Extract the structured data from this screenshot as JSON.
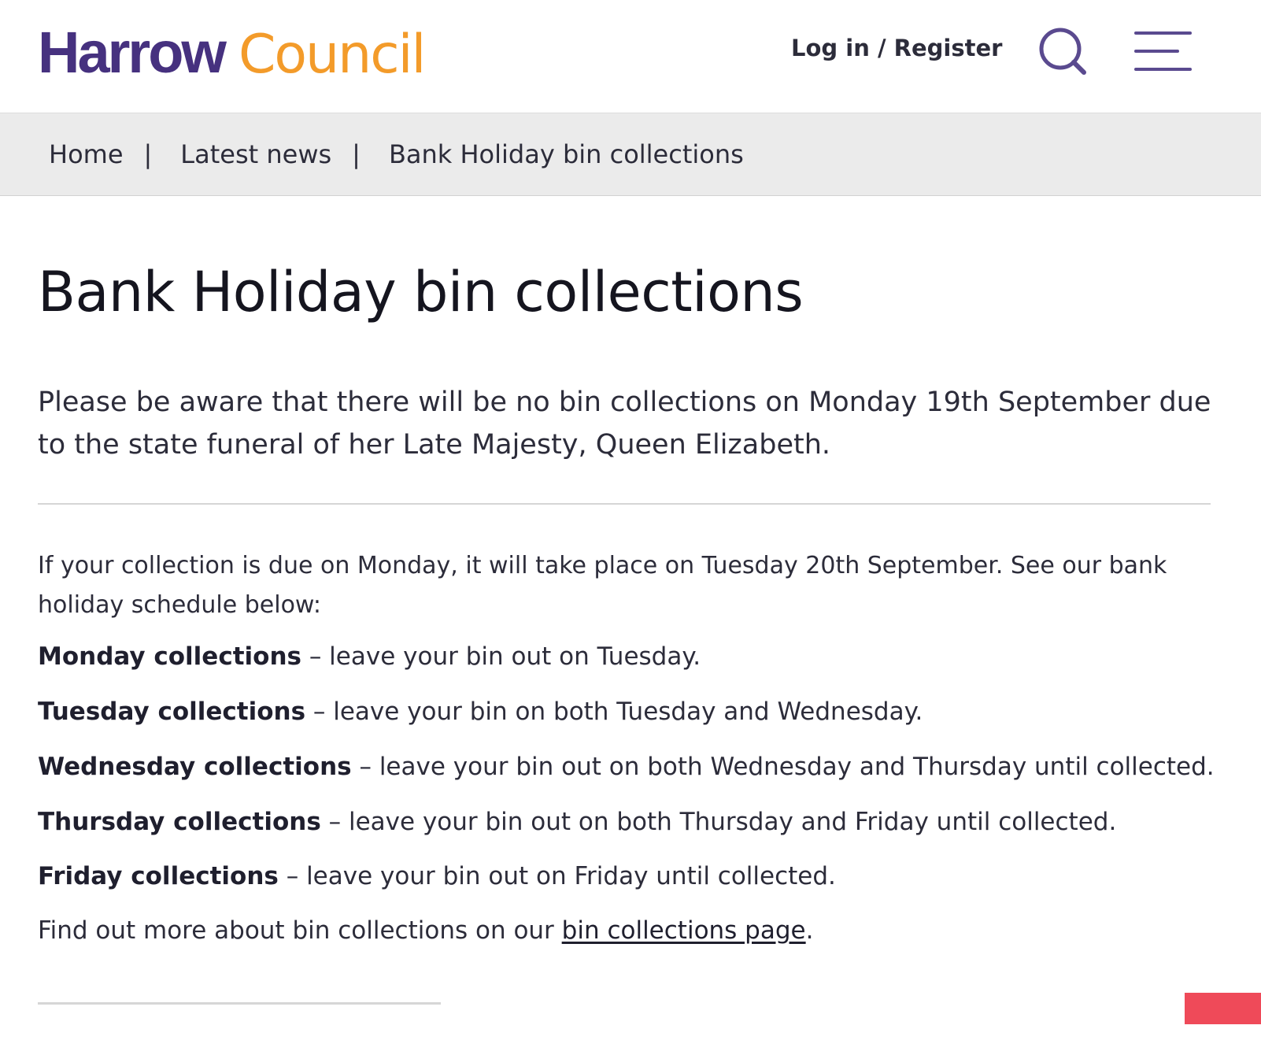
{
  "header": {
    "logo_primary": "Harrow",
    "logo_secondary": "Council",
    "login_label": "Log in / Register",
    "search_icon": "search-icon",
    "menu_icon": "hamburger-menu-icon",
    "brand_purple": "#46317f",
    "brand_orange": "#f39b2a"
  },
  "breadcrumb": {
    "items": [
      {
        "label": "Home"
      },
      {
        "label": "Latest news"
      },
      {
        "label": "Bank Holiday bin collections"
      }
    ],
    "separator": "|"
  },
  "article": {
    "title": "Bank Holiday bin collections",
    "intro": "Please be aware that there will be no bin collections on Monday 19th September due to the state funeral of her Late Majesty, Queen Elizabeth.",
    "paragraph": "If your collection is due on Monday, it will take place on Tuesday 20th September. See our bank holiday schedule below:",
    "schedule": [
      {
        "day": "Monday collections",
        "text": " – leave your bin out on Tuesday."
      },
      {
        "day": "Tuesday collections",
        "text": " – leave your bin on both Tuesday and Wednesday."
      },
      {
        "day": "Wednesday collections",
        "text": " – leave your bin out on both Wednesday and Thursday until collected."
      },
      {
        "day": "Thursday collections",
        "text": " – leave your bin out on both Thursday and Friday until collected."
      },
      {
        "day": "Friday collections",
        "text": " – leave your bin out on Friday until collected."
      }
    ],
    "more_prefix": "Find out more about bin collections on our ",
    "more_link": "bin collections page",
    "more_suffix": "."
  },
  "colors": {
    "breadcrumb_bg": "#ebebeb",
    "corner_accent": "#ef4a59"
  }
}
